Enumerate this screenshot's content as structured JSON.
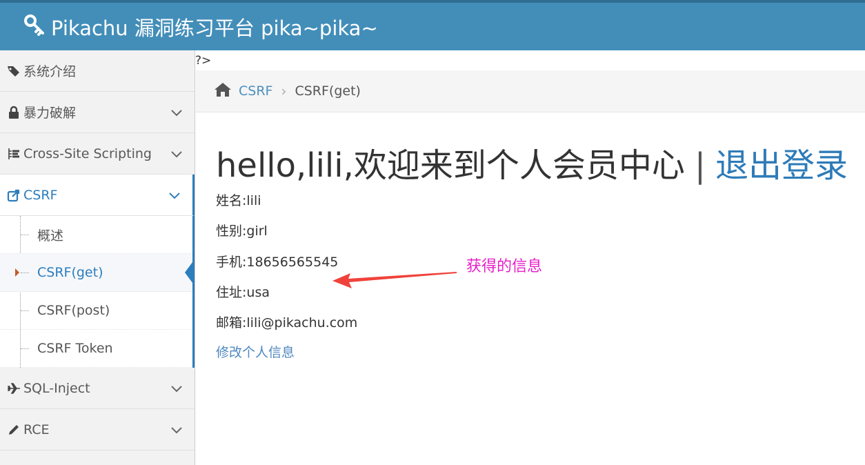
{
  "header": {
    "brand": "Pikachu 漏洞练习平台 pika~pika~"
  },
  "sidebar": {
    "items": [
      {
        "label": "系统介绍"
      },
      {
        "label": "暴力破解"
      },
      {
        "label": "Cross-Site Scripting"
      },
      {
        "label": "CSRF"
      },
      {
        "label": "SQL-Inject"
      },
      {
        "label": "RCE"
      }
    ],
    "csrf_sub": [
      {
        "label": "概述"
      },
      {
        "label": "CSRF(get)"
      },
      {
        "label": "CSRF(post)"
      },
      {
        "label": "CSRF Token"
      }
    ]
  },
  "php_leak": "?>",
  "breadcrumb": {
    "section": "CSRF",
    "current": "CSRF(get)"
  },
  "main": {
    "welcome": "hello,lili,欢迎来到个人会员中心",
    "separator": "|",
    "logout": "退出登录",
    "fields": {
      "name": "姓名:lili",
      "gender": "性别:girl",
      "phone": "手机:18656565545",
      "address": "住址:usa",
      "email": "邮箱:lili@pikachu.com"
    },
    "edit_link": "修改个人信息"
  },
  "annotation": {
    "text": "获得的信息",
    "color": "#e81ec8"
  },
  "colors": {
    "header": "#438eb9",
    "accent": "#2b7dbc"
  }
}
